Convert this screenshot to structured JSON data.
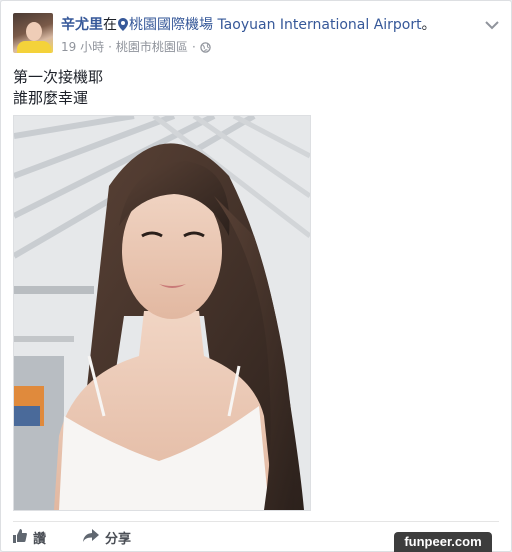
{
  "post": {
    "author": "辛尤里",
    "in_word": "在",
    "place": "桃園國際機場 Taoyuan International Airport",
    "period": "。",
    "time": "19 小時",
    "separator": "·",
    "location": "桃園市桃園區",
    "separator2": "·",
    "text_line1": "第一次接機耶",
    "text_line2": "誰那麼幸運"
  },
  "actions": {
    "like_label": "讚",
    "share_label": "分享"
  },
  "watermark": "funpeer.com",
  "icons": {
    "pin": "map-pin-icon",
    "globe": "globe-icon",
    "chevron": "chevron-down-icon",
    "like": "thumbs-up-icon",
    "share": "share-arrow-icon"
  },
  "colors": {
    "link": "#365899",
    "meta": "#90949c",
    "text": "#1d2129"
  }
}
